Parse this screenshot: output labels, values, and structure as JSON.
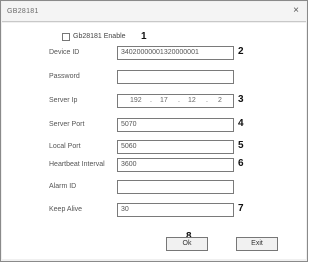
{
  "window": {
    "title": "GB28181"
  },
  "enable": {
    "label": "Gb28181 Enable",
    "checked": false,
    "marker": "1"
  },
  "fields": {
    "device_id": {
      "label": "Device ID",
      "value": "34020000001320000001",
      "marker": "2"
    },
    "password": {
      "label": "Password",
      "value": ""
    },
    "server_ip": {
      "label": "Server Ip",
      "octets": [
        "192",
        "17",
        "12",
        "2"
      ],
      "marker": "3"
    },
    "server_port": {
      "label": "Server Port",
      "value": "5070",
      "marker": "4"
    },
    "local_port": {
      "label": "Local Port",
      "value": "5060",
      "marker": "5"
    },
    "heartbeat_interval": {
      "label": "Heartbeat Interval",
      "value": "3600",
      "marker": "6"
    },
    "alarm_id": {
      "label": "Alarm ID",
      "value": ""
    },
    "keep_alive": {
      "label": "Keep Alive",
      "value": "30",
      "marker": "7"
    }
  },
  "buttons": {
    "ok": "Ok",
    "exit": "Exit",
    "marker": "8"
  }
}
